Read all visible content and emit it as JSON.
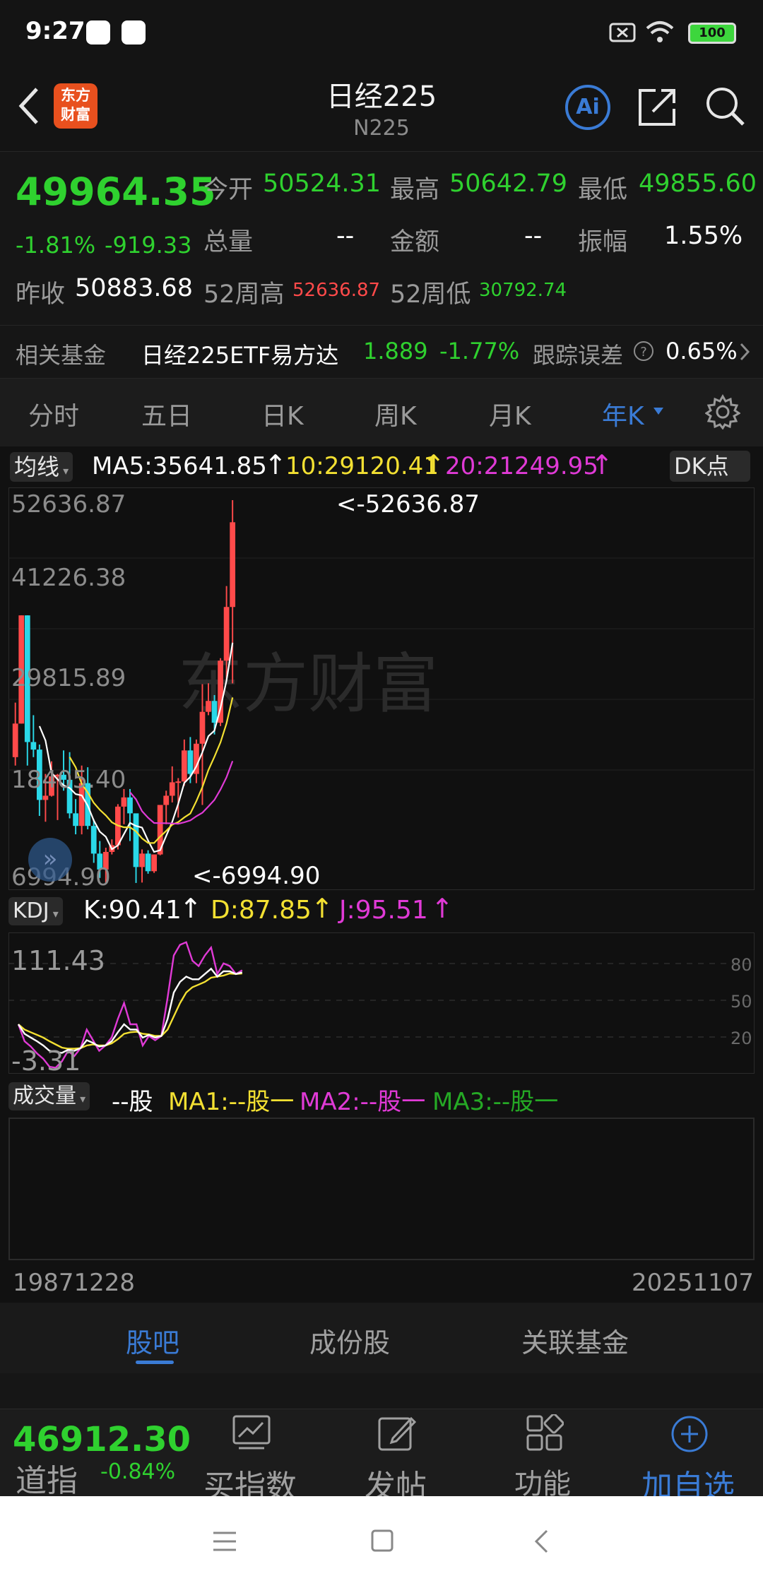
{
  "status": {
    "time": "9:27",
    "battery": "100"
  },
  "header": {
    "back_icon": "chevron-left-icon",
    "logo": "东方\n财富",
    "title": "日经225",
    "subtitle": "N225",
    "ai_label": "Ai"
  },
  "quote": {
    "price": "49964.35",
    "change_pct": "-1.81%",
    "change": "-919.33",
    "open_label": "今开",
    "open": "50524.31",
    "high_label": "最高",
    "high": "50642.79",
    "low_label": "最低",
    "low": "49855.60",
    "volume_label": "总量",
    "volume": "--",
    "amount_label": "金额",
    "amount": "--",
    "amplitude_label": "振幅",
    "amplitude": "1.55%",
    "prev_close_label": "昨收",
    "prev_close": "50883.68",
    "w52_high_label": "52周高",
    "w52_high": "52636.87",
    "w52_low_label": "52周低",
    "w52_low": "30792.74"
  },
  "fund": {
    "label": "相关基金",
    "name": "日经225ETF易方达",
    "price": "1.889",
    "change": "-1.77%",
    "tracking_label": "跟踪误差",
    "tracking_value": "0.65%"
  },
  "tabs": [
    "分时",
    "五日",
    "日K",
    "周K",
    "月K",
    "年K"
  ],
  "main_chart": {
    "ma_selector": "均线",
    "ma5": "MA5:35641.85",
    "ma10": "10:29120.41",
    "ma20": "20:21249.95",
    "dk_label": "DK点",
    "y_labels": [
      "52636.87",
      "41226.38",
      "29815.89",
      "18405.40",
      "6994.90"
    ],
    "max_marker": "<-52636.87",
    "min_marker": "<-6994.90",
    "watermark": "东方财富"
  },
  "kdj": {
    "selector": "KDJ",
    "k": "K:90.41",
    "d": "D:87.85",
    "j": "J:95.51",
    "y_top": "111.43",
    "y_bottom": "-3.31",
    "levels": [
      "80",
      "50",
      "20"
    ]
  },
  "volume": {
    "selector": "成交量",
    "unit": "--股",
    "ma1": "MA1:--股一",
    "ma2": "MA2:--股一",
    "ma3": "MA3:--股一",
    "date_start": "19871228",
    "date_end": "20251107"
  },
  "bottom_tabs": [
    "股吧",
    "成份股",
    "关联基金"
  ],
  "footer": {
    "index_price": "46912.30",
    "index_name": "道指",
    "index_change": "-0.84%",
    "buy_label": "买指数",
    "post_label": "发帖",
    "func_label": "功能",
    "add_label": "加自选"
  },
  "chart_data": {
    "type": "candlestick",
    "title": "日经225",
    "ylim": [
      6994.9,
      52636.87
    ],
    "x_range": [
      "19871228",
      "20251107"
    ],
    "y_ticks": [
      52636.87,
      41226.38,
      29815.89,
      18405.4,
      6994.9
    ],
    "series": [
      {
        "name": "MA5",
        "last": 35641.85
      },
      {
        "name": "10",
        "last": 29120.41
      },
      {
        "name": "20",
        "last": 21249.95
      }
    ]
  },
  "colors": {
    "up": "#ff4a4a",
    "down": "#2fd12f",
    "accent": "#3a7bd5",
    "ma5": "#ffffff",
    "ma10": "#f3e032",
    "ma20": "#e03ad6"
  }
}
